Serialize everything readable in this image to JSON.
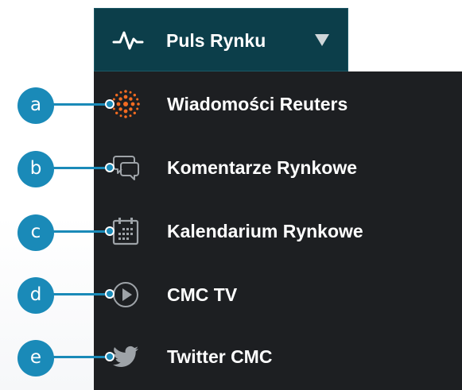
{
  "header": {
    "label": "Puls Rynku",
    "icon": "pulse-icon",
    "caret_icon": "caret-down-icon"
  },
  "menu": {
    "items": [
      {
        "id": "reuters",
        "label": "Wiadomości Reuters",
        "icon": "reuters-icon",
        "badge": "a"
      },
      {
        "id": "comments",
        "label": "Komentarze Rynkowe",
        "icon": "chat-bubbles-icon",
        "badge": "b"
      },
      {
        "id": "calendar",
        "label": "Kalendarium Rynkowe",
        "icon": "calendar-icon",
        "badge": "c"
      },
      {
        "id": "tv",
        "label": "CMC TV",
        "icon": "play-circle-icon",
        "badge": "d"
      },
      {
        "id": "twitter",
        "label": "Twitter CMC",
        "icon": "twitter-bird-icon",
        "badge": "e"
      }
    ]
  },
  "colors": {
    "header_bg": "#0c3e4a",
    "dropdown_bg": "#1d1f22",
    "callout": "#1a8ab8",
    "reuters_orange": "#f26b21",
    "icon_grey": "#9ea3a8"
  }
}
